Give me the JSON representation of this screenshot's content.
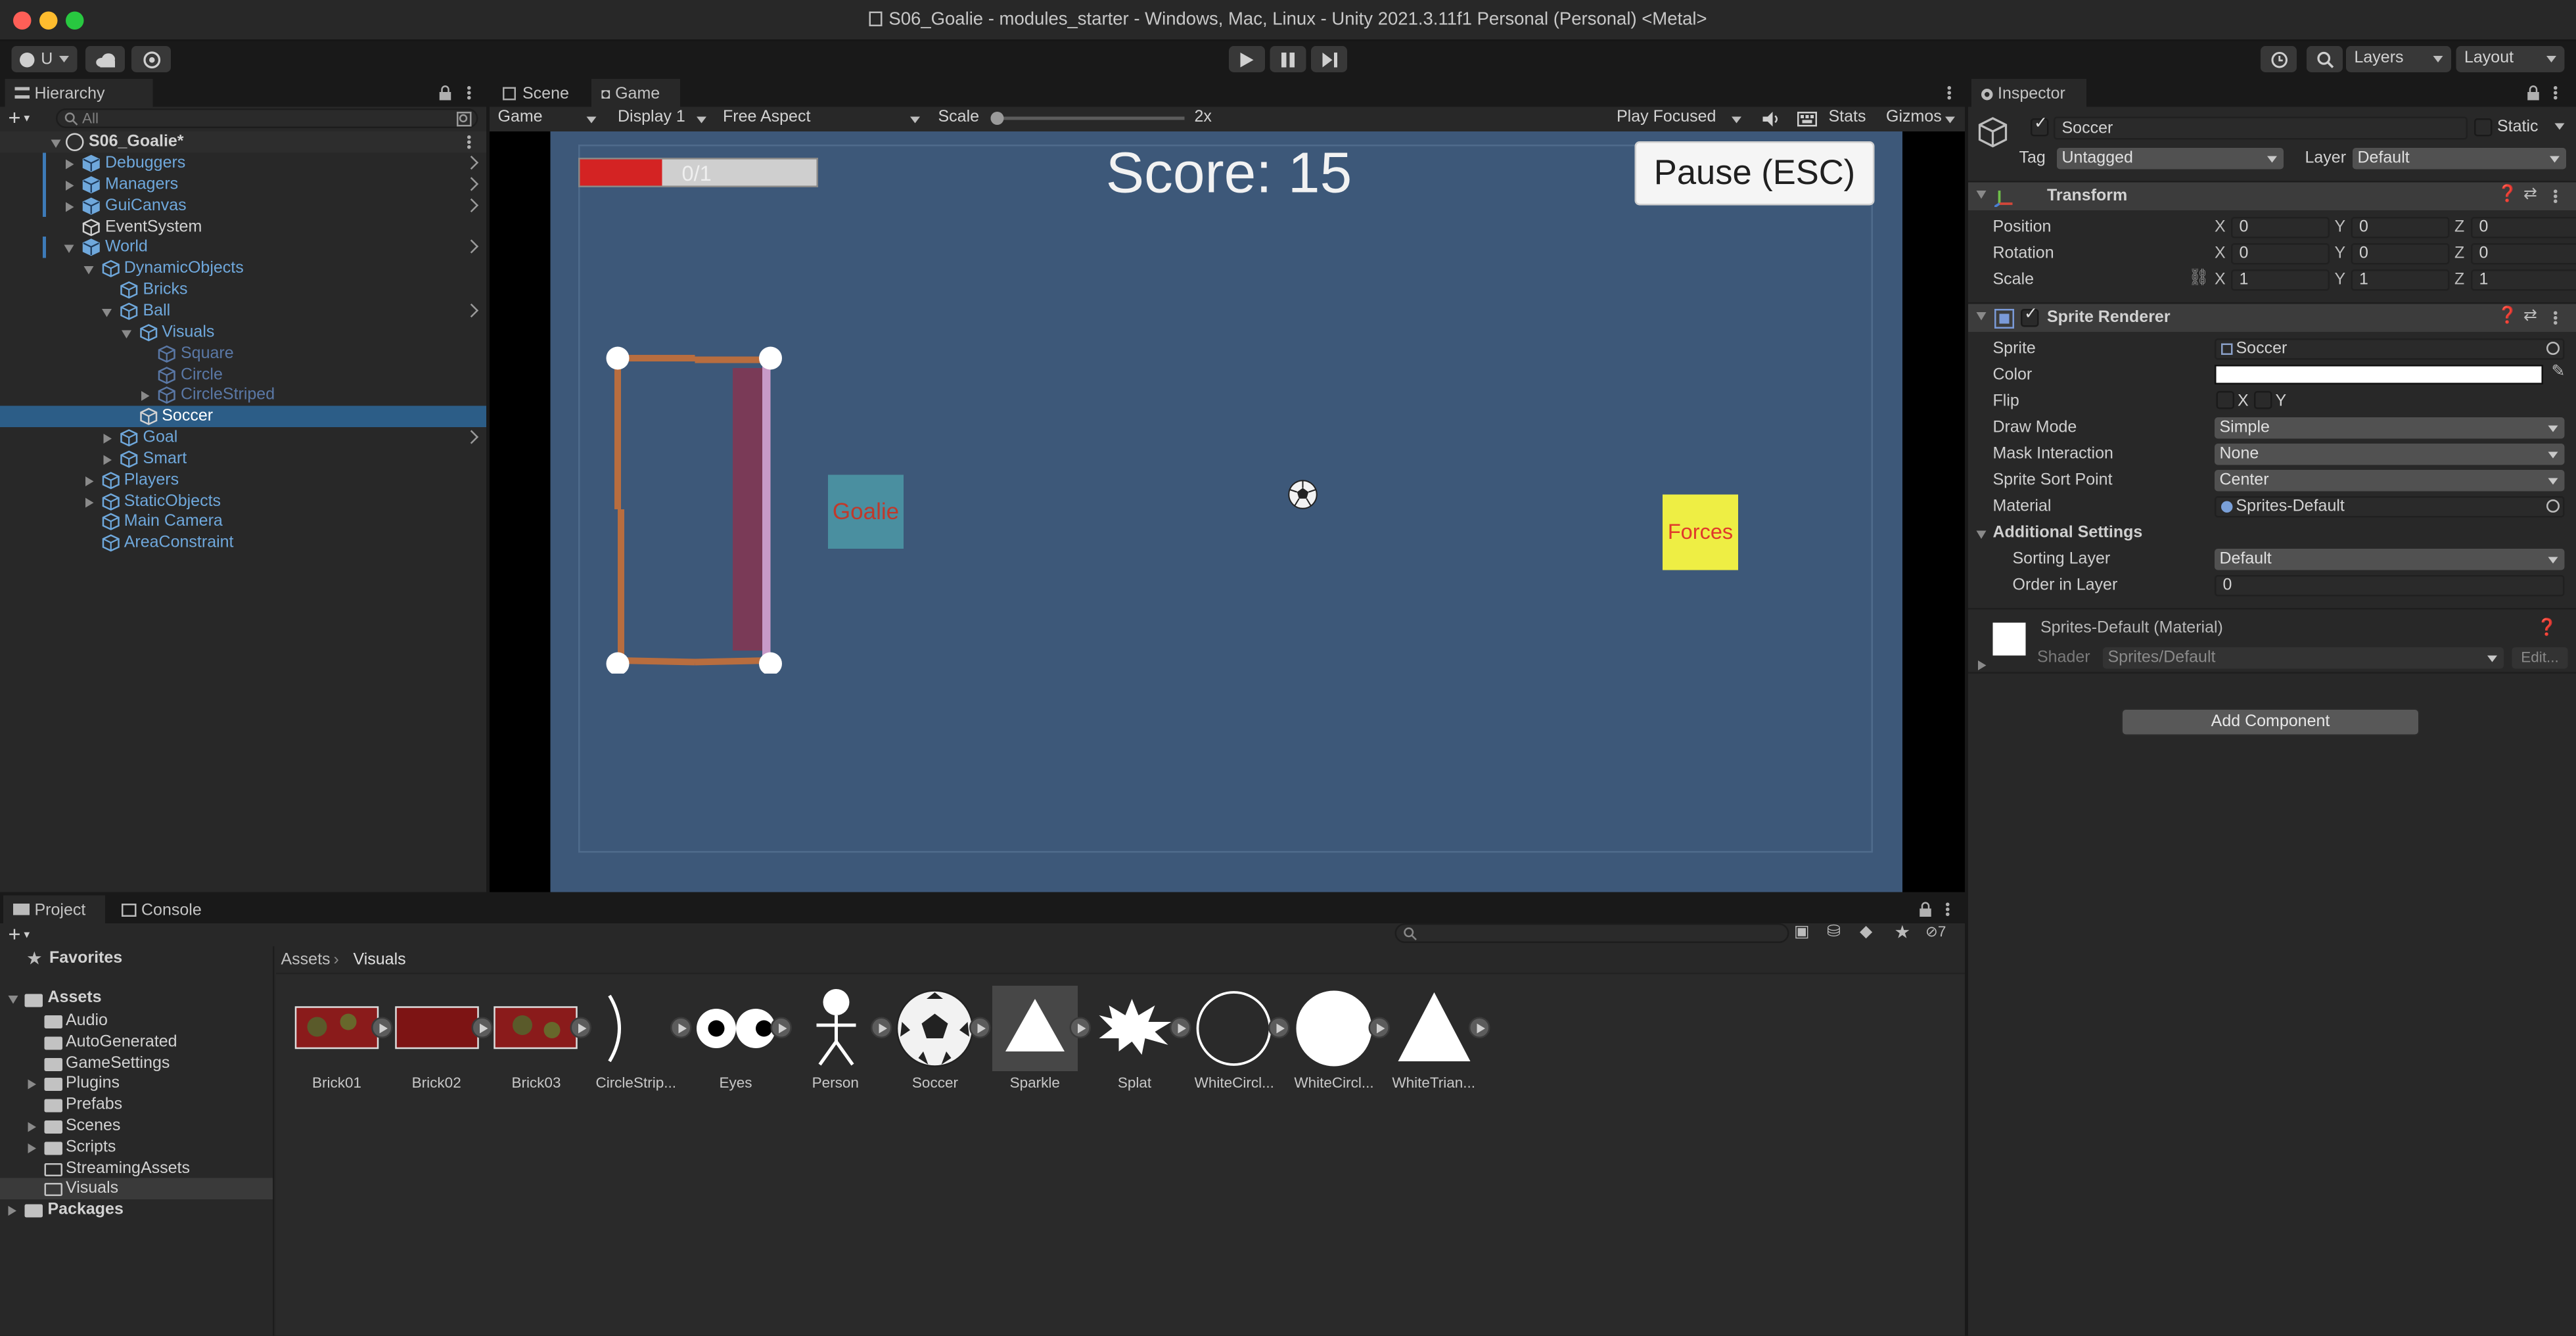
{
  "window": {
    "title": "S06_Goalie - modules_starter - Windows, Mac, Linux - Unity 2021.3.11f1 Personal (Personal) <Metal>"
  },
  "toolbar": {
    "account": "U",
    "layers": "Layers",
    "layout": "Layout"
  },
  "hierarchy": {
    "tab": "Hierarchy",
    "search_placeholder": "All",
    "scene": "S06_Goalie*",
    "items": [
      "Debuggers",
      "Managers",
      "GuiCanvas",
      "EventSystem",
      "World",
      "DynamicObjects",
      "Bricks",
      "Ball",
      "Visuals",
      "Square",
      "Circle",
      "CircleStriped",
      "Soccer",
      "Goal",
      "Smart",
      "Players",
      "StaticObjects",
      "Main Camera",
      "AreaConstraint"
    ]
  },
  "tabs": {
    "scene": "Scene",
    "game": "Game"
  },
  "game_toolbar": {
    "display_mode": "Game",
    "display": "Display 1",
    "aspect": "Free Aspect",
    "scale_label": "Scale",
    "scale_value": "2x",
    "play_mode": "Play Focused",
    "stats": "Stats",
    "gizmos": "Gizmos"
  },
  "game": {
    "progress_text": "0/1",
    "progress": 0.35,
    "score": "Score: 15",
    "pause_button": "Pause (ESC)",
    "goalie_label": "Goalie",
    "forces_label": "Forces"
  },
  "inspector": {
    "tab": "Inspector",
    "object_name": "Soccer",
    "static_label": "Static",
    "tag_label": "Tag",
    "tag_value": "Untagged",
    "layer_label": "Layer",
    "layer_value": "Default",
    "transform": {
      "title": "Transform",
      "position_label": "Position",
      "rotation_label": "Rotation",
      "scale_label": "Scale",
      "position": [
        "0",
        "0",
        "0"
      ],
      "rotation": [
        "0",
        "0",
        "0"
      ],
      "scale": [
        "1",
        "1",
        "1"
      ]
    },
    "sprite_renderer": {
      "title": "Sprite Renderer",
      "sprite_label": "Sprite",
      "sprite_value": "Soccer",
      "color_label": "Color",
      "color_value": "#ffffff",
      "flip_label": "Flip",
      "flip_x": "X",
      "flip_y": "Y",
      "draw_mode_label": "Draw Mode",
      "draw_mode_value": "Simple",
      "mask_label": "Mask Interaction",
      "mask_value": "None",
      "sort_point_label": "Sprite Sort Point",
      "sort_point_value": "Center",
      "material_label": "Material",
      "material_value": "Sprites-Default",
      "additional_label": "Additional Settings",
      "sorting_layer_label": "Sorting Layer",
      "sorting_layer_value": "Default",
      "order_label": "Order in Layer",
      "order_value": "0"
    },
    "material": {
      "title": "Sprites-Default (Material)",
      "shader_label": "Shader",
      "shader_value": "Sprites/Default",
      "edit": "Edit..."
    },
    "add_component": "Add Component"
  },
  "project": {
    "tab_project": "Project",
    "tab_console": "Console",
    "favorites": "Favorites",
    "assets_root": "Assets",
    "folders": [
      "Audio",
      "AutoGenerated",
      "GameSettings",
      "Plugins",
      "Prefabs",
      "Scenes",
      "Scripts",
      "StreamingAssets",
      "Visuals"
    ],
    "packages": "Packages",
    "breadcrumb_root": "Assets",
    "breadcrumb_current": "Visuals",
    "hidden_count": "7",
    "assets": [
      "Brick01",
      "Brick02",
      "Brick03",
      "CircleStrip...",
      "Eyes",
      "Person",
      "Soccer",
      "Sparkle",
      "Splat",
      "WhiteCircl...",
      "WhiteCircl...",
      "WhiteTrian..."
    ]
  },
  "colors": {
    "game_bg": "#3d5879",
    "score_text": "#f2f2f2",
    "goalie_box": "#4a8fa0",
    "goalie_text": "#c0392b",
    "forces_box": "#eeee44",
    "forces_text": "#e0392b",
    "goal_frame": "#b86d3f",
    "goal_net": "#7a3a57",
    "progress_fill": "#d42323",
    "selection": "#2c5d87"
  }
}
